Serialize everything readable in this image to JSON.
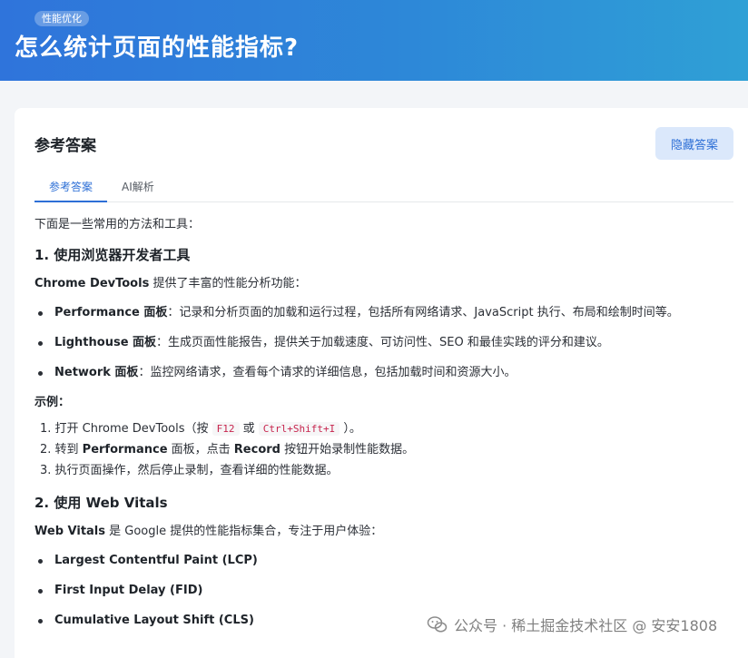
{
  "header": {
    "tag": "性能优化",
    "title": "怎么统计页面的性能指标?"
  },
  "card": {
    "title": "参考答案",
    "hide_button": "隐藏答案",
    "tabs": [
      "参考答案",
      "AI解析"
    ]
  },
  "content": {
    "intro": "下面是一些常用的方法和工具：",
    "s1_heading": "1. 使用浏览器开发者工具",
    "s1_lead_bold": "Chrome DevTools",
    "s1_lead_rest": " 提供了丰富的性能分析功能：",
    "s1_items": [
      {
        "bold": "Performance 面板",
        "text": "：记录和分析页面的加载和运行过程，包括所有网络请求、JavaScript 执行、布局和绘制时间等。"
      },
      {
        "bold": "Lighthouse 面板",
        "text": "：生成页面性能报告，提供关于加载速度、可访问性、SEO 和最佳实践的评分和建议。"
      },
      {
        "bold": "Network 面板",
        "text": "：监控网络请求，查看每个请求的详细信息，包括加载时间和资源大小。"
      }
    ],
    "example_label": "示例：",
    "step1_a": "1. 打开 Chrome DevTools（按 ",
    "step1_code1": "F12",
    "step1_b": " 或 ",
    "step1_code2": "Ctrl+Shift+I",
    "step1_c": " ）。",
    "step2_a": "2. 转到 ",
    "step2_b1": "Performance",
    "step2_b": " 面板，点击 ",
    "step2_b2": "Record",
    "step2_c": " 按钮开始录制性能数据。",
    "step3": "3. 执行页面操作，然后停止录制，查看详细的性能数据。",
    "s2_heading_a": "2. 使用 ",
    "s2_heading_b": "Web Vitals",
    "s2_lead_bold": "Web Vitals",
    "s2_lead_rest": " 是 Google 提供的性能指标集合，专注于用户体验：",
    "s2_items": [
      "Largest Contentful Paint (LCP)",
      "First Input Delay (FID)",
      "Cumulative Layout Shift (CLS)"
    ]
  },
  "watermark": {
    "text": "公众号 · 稀土掘金技术社区 @ 安安1808"
  }
}
